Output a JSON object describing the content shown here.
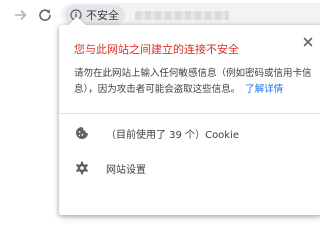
{
  "toolbar": {
    "forward_icon": "arrow-right-icon",
    "reload_icon": "reload-icon"
  },
  "omnibox": {
    "security_chip_label": "不安全",
    "security_icon": "info-circle-icon"
  },
  "popup": {
    "title": "您与此网站之间建立的连接不安全",
    "body_text": "请勿在此网站上输入任何敏感信息（例如密码或信用卡信息），因为攻击者可能会盗取这些信息。",
    "learn_more": "了解详情",
    "close_icon": "close-icon",
    "cookies_label": "（目前使用了 39 个）Cookie",
    "cookies_icon": "cookie-icon",
    "site_settings_label": "网站设置",
    "site_settings_icon": "gear-icon"
  },
  "colors": {
    "danger": "#d93025",
    "link": "#1a73e8",
    "text": "#3c4043"
  }
}
